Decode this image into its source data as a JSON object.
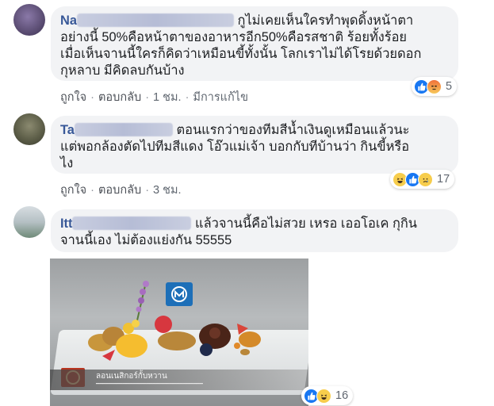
{
  "comments": [
    {
      "name_visible_prefix": "Na",
      "text_lines": [
        "กูไม่เคยเห็นใครทำพุดดิ้งหน้าตา",
        "อย่างนี้ 50%คือหน้าตาของอาหารอีก50%คือรสชาติ ร้อยทั้งร้อย",
        "เมื่อเห็นจานนี้ใครก็คิดว่าเหมือนขี้ทั้งนั้น โลกเราไม่ได้โรยด้วยดอก",
        "กุหลาบ มีคิดลบกันบ้าง"
      ],
      "like": "ถูกใจ",
      "reply": "ตอบกลับ",
      "time": "1 ชม.",
      "edited": "มีการแก้ไข",
      "reaction_icons": [
        "like-icon",
        "angry-icon"
      ],
      "reaction_count": "5"
    },
    {
      "name_visible_prefix": "Ta",
      "text_lines": [
        "ตอนแรกว่าของทีมสีน้ำเงินดูเหมือนแล้วนะ",
        "แต่พอกล้องตัดไปทีมสีแดง โอ๊วแม่เจ้า บอกกับทีบ้านว่า กินขี้หรือ",
        "ไง"
      ],
      "like": "ถูกใจ",
      "reply": "ตอบกลับ",
      "time": "3 ชม.",
      "reaction_icons": [
        "haha-icon",
        "like-icon",
        "sad-icon"
      ],
      "reaction_count": "17"
    },
    {
      "name_visible_prefix": "Itt",
      "text_lines": [
        "แล้วจานนี้คือไม่สวย เหรอ เออโอเค กุกิน",
        "จานนี้เอง ไม่ต้องแย่งกัน 55555"
      ],
      "reaction_icons": [
        "like-icon",
        "haha-icon"
      ],
      "reaction_count": "16",
      "photo": {
        "overlay_caption": "ลอนเนสิกอร์กั้บหวาน"
      }
    }
  ],
  "colors": {
    "name_link": "#385898",
    "bubble_bg": "#f2f3f5",
    "like_blue": "#1877f2",
    "angry_orange": "#f0703a",
    "haha_yellow": "#f7cd4c"
  }
}
